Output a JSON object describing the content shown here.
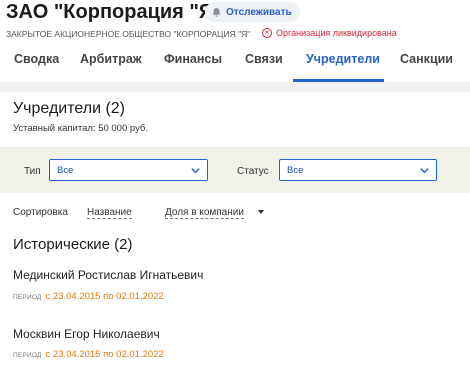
{
  "header": {
    "company_title": "ЗАО \"Корпорация \"Я\"",
    "follow_label": "Отслеживать",
    "full_name": "ЗАКРЫТОЕ АКЦИОНЕРНОЕ ОБЩЕСТВО \"КОРПОРАЦИЯ \"Я\"",
    "status_badge": "Организация ликвидирована",
    "status_color": "#d6283c",
    "icons": {
      "follow": "bell-icon",
      "status": "close-circle-icon"
    }
  },
  "tabs": [
    {
      "label": "Сводка"
    },
    {
      "label": "Арбитраж"
    },
    {
      "label": "Финансы"
    },
    {
      "label": "Связи"
    },
    {
      "label": "Учредители",
      "active": true
    },
    {
      "label": "Санкции"
    }
  ],
  "accent_color": "#2760c9",
  "founders": {
    "title": "Учредители (2)",
    "capital": "Уставный капитал: 50 000 руб.",
    "filters": {
      "type_label": "Тип",
      "type_value": "Все",
      "status_label": "Статус",
      "status_value": "Все"
    },
    "sort": {
      "label": "Сортировка",
      "options": [
        "Название",
        "Доля в компании"
      ]
    },
    "historical_title": "Исторические (2)",
    "people": [
      {
        "name": "Мединский Ростислав Игнатьевич",
        "period_label": "ПЕРИОД",
        "period": "с 23.04.2015 по 02.01.2022"
      },
      {
        "name": "Москвин Егор Николаевич",
        "period_label": "ПЕРИОД",
        "period": "с 23.04.2015 по 02.01.2022"
      }
    ]
  }
}
